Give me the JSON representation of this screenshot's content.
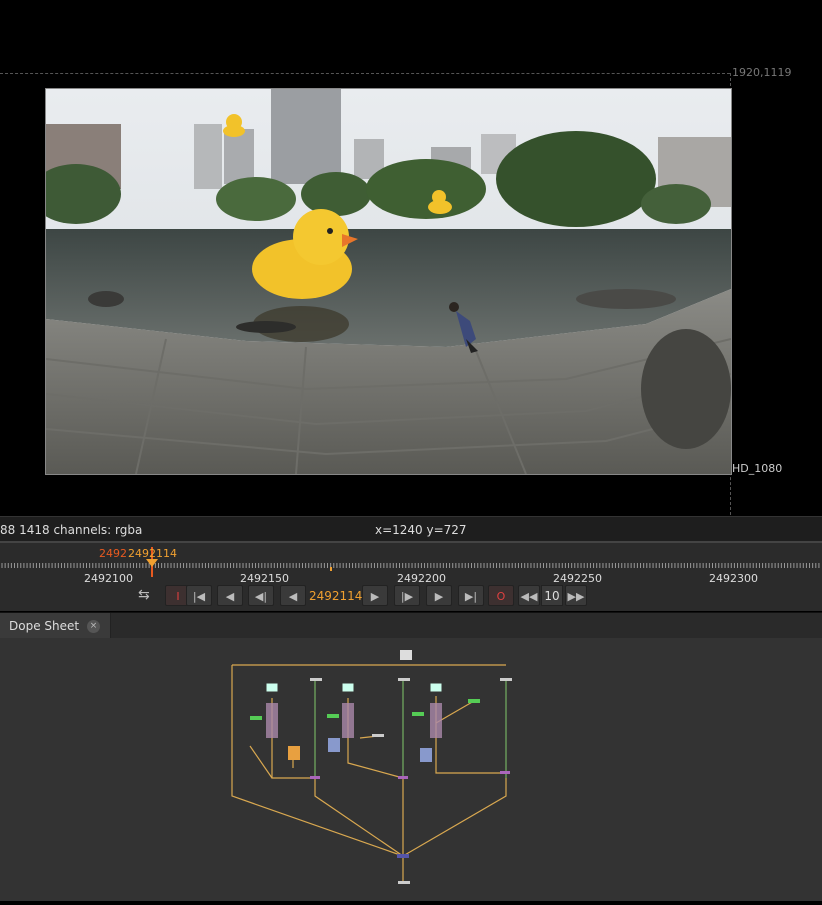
{
  "viewer": {
    "format_top": "1920,1119",
    "format_bottom": "HD_1080"
  },
  "infobar": {
    "left_text": "88 1418 channels: rgba",
    "coords_text": "x=1240 y=727"
  },
  "timeline": {
    "current_frame": "2492114",
    "marker_text": "2492",
    "marker_text2": "2492114",
    "labels": [
      "2492100",
      "2492150",
      "2492200",
      "2492250",
      "2492300"
    ]
  },
  "controls": {
    "frame_value": "2492114",
    "increment": "10",
    "in_label": "I",
    "out_label": "O"
  },
  "tabs": [
    {
      "label": "Dope Sheet",
      "close": "×"
    }
  ],
  "colors": {
    "accent": "#f0a030",
    "playhead": "#e85a20",
    "wire": "#d9a850",
    "graph_bg": "#333333"
  }
}
